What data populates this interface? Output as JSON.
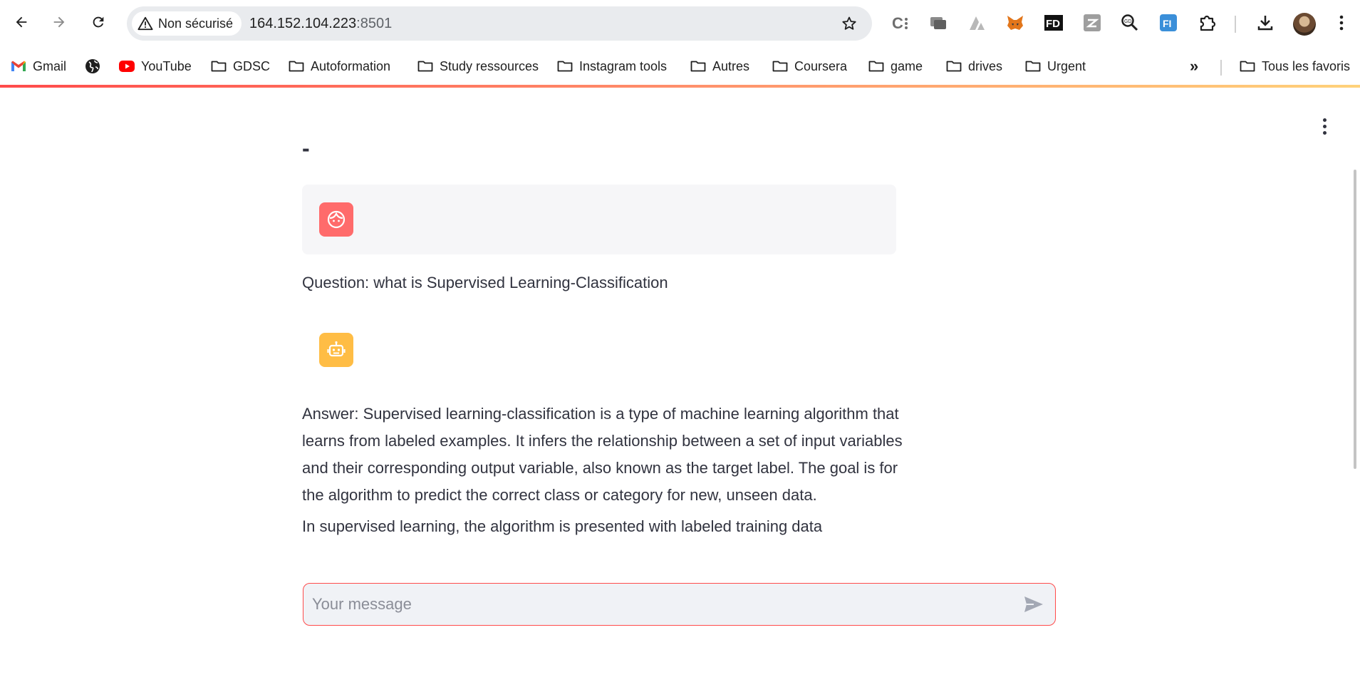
{
  "browser": {
    "security_label": "Non sécurisé",
    "url_host": "164.152.104.223",
    "url_port": ":8501",
    "extensions": [
      "c-extension-icon",
      "tabs-extension-icon",
      "arrow-extension-icon",
      "metamask-fox-icon",
      "fd-extension-icon",
      "zotero-extension-icon",
      "search-extension-icon",
      "fi-extension-icon",
      "puzzle-extensions-icon"
    ]
  },
  "bookmarks": {
    "items": [
      {
        "label": "Gmail",
        "icon": "gmail-icon"
      },
      {
        "label": "",
        "icon": "globe-icon"
      },
      {
        "label": "YouTube",
        "icon": "youtube-icon"
      },
      {
        "label": "GDSC",
        "icon": "folder-icon"
      },
      {
        "label": "Autoformation",
        "icon": "folder-icon"
      },
      {
        "label": "Study ressources",
        "icon": "folder-icon"
      },
      {
        "label": "Instagram tools",
        "icon": "folder-icon"
      },
      {
        "label": "Autres",
        "icon": "folder-icon"
      },
      {
        "label": "Coursera",
        "icon": "folder-icon"
      },
      {
        "label": "game",
        "icon": "folder-icon"
      },
      {
        "label": "drives",
        "icon": "folder-icon"
      },
      {
        "label": "Urgent",
        "icon": "folder-icon"
      }
    ],
    "overflow": "»",
    "all_bookmarks": "Tous les favoris"
  },
  "app": {
    "title": "-",
    "question": "Question: what is Supervised Learning-Classification",
    "answer": "Answer: Supervised learning-classification is a type of machine learning algorithm that learns from labeled examples. It infers the relationship between a set of input variables and their corresponding output variable, also known as the target label. The goal is for the algorithm to predict the correct class or category for new, unseen data.",
    "answer_cutoff": "In supervised learning, the algorithm is presented with labeled training data",
    "input_placeholder": "Your message",
    "colors": {
      "accent": "#ff4b4b",
      "user_avatar": "#ff6b6b",
      "bot_avatar": "#ffbd45"
    }
  }
}
